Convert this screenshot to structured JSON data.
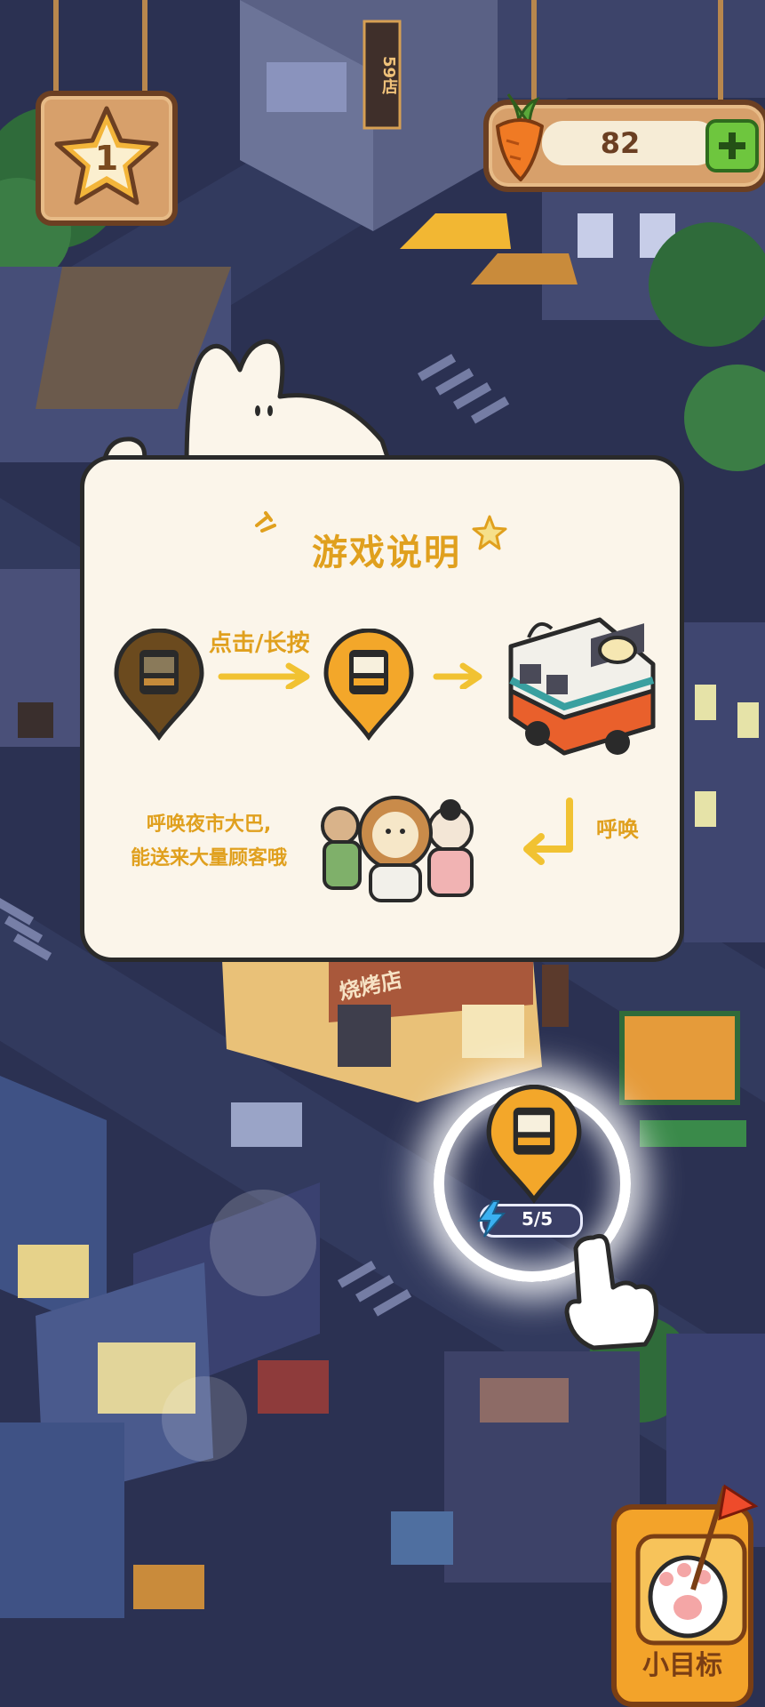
{
  "hud": {
    "level": "1",
    "carrot_count": "82"
  },
  "tutorial": {
    "title": "游戏说明",
    "step_action": "点击/长按",
    "step_result": "呼唤",
    "description_line1": "呼唤夜市大巴,",
    "description_line2": "能送来大量顾客哦"
  },
  "map": {
    "shop_sign": "烧烤店",
    "building_sign": "59店",
    "bus_energy": "5/5"
  },
  "goal_button": {
    "label": "小目标"
  },
  "colors": {
    "accent_yellow": "#e0a01e",
    "wood": "#d7a06b",
    "plus_green": "#6ec63e"
  }
}
